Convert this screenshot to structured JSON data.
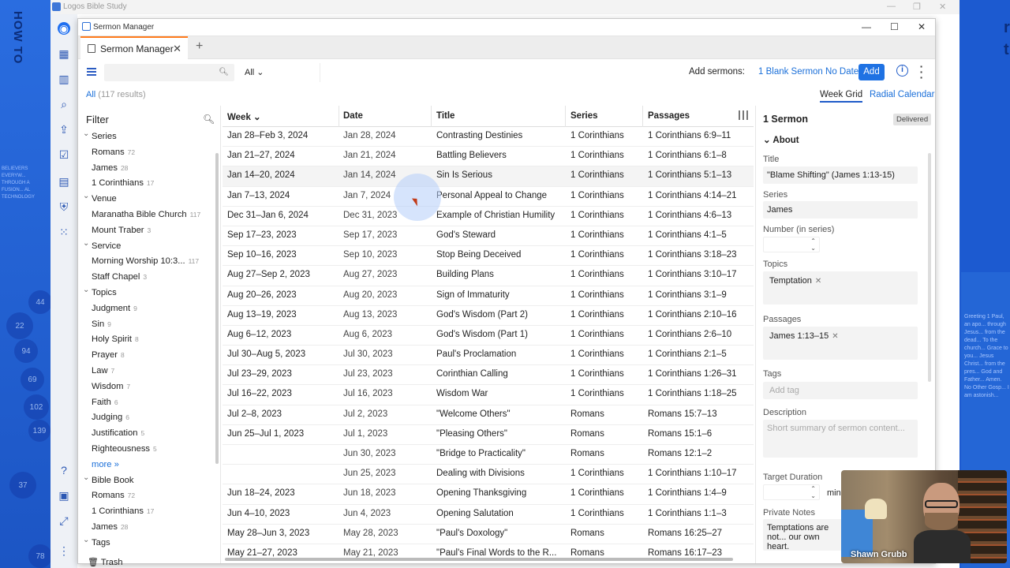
{
  "background": {
    "left_header": "HOW TO",
    "left_text": "BELIEVERS EVERYW... THROUGH A FUSION... AL TECHNOLOGY",
    "left_circles": [
      "44",
      "22",
      "94",
      "69",
      "102",
      "139",
      "37",
      "78"
    ],
    "right_letters": [
      "r",
      "t"
    ],
    "right_doc": "Greeting 1 Paul, an apo... through Jesus... from the dead... To the church... Grace to you... Jesus Christ... from the pres... God and Father... Amen. No Other Gosp... I am astonish..."
  },
  "logos": {
    "title": "Logos Bible Study"
  },
  "window": {
    "title": "Sermon Manager",
    "tab_label": "Sermon Manager"
  },
  "toolbar": {
    "search_placeholder": "",
    "filter_dropdown": "All",
    "add_sermons_label": "Add sermons:",
    "blank_sermon_link": "1 Blank Sermon No Date",
    "add_button": "Add"
  },
  "results": {
    "scope": "All",
    "count": "(117 results)"
  },
  "views": {
    "week_grid": "Week Grid",
    "radial_calendar": "Radial Calendar"
  },
  "filter": {
    "title": "Filter",
    "more_label": "more »",
    "trash_label": "Trash",
    "rows": [
      {
        "kind": "group",
        "label": "Series"
      },
      {
        "kind": "item",
        "label": "Romans",
        "count": "72"
      },
      {
        "kind": "item",
        "label": "James",
        "count": "28"
      },
      {
        "kind": "item",
        "label": "1 Corinthians",
        "count": "17"
      },
      {
        "kind": "group",
        "label": "Venue"
      },
      {
        "kind": "item",
        "label": "Maranatha Bible Church",
        "count": "117"
      },
      {
        "kind": "item",
        "label": "Mount Traber",
        "count": "3"
      },
      {
        "kind": "group",
        "label": "Service"
      },
      {
        "kind": "item",
        "label": "Morning Worship 10:3...",
        "count": "117"
      },
      {
        "kind": "item",
        "label": "Staff Chapel",
        "count": "3"
      },
      {
        "kind": "group",
        "label": "Topics"
      },
      {
        "kind": "item",
        "label": "Judgment",
        "count": "9"
      },
      {
        "kind": "item",
        "label": "Sin",
        "count": "9"
      },
      {
        "kind": "item",
        "label": "Holy Spirit",
        "count": "8"
      },
      {
        "kind": "item",
        "label": "Prayer",
        "count": "8"
      },
      {
        "kind": "item",
        "label": "Law",
        "count": "7"
      },
      {
        "kind": "item",
        "label": "Wisdom",
        "count": "7"
      },
      {
        "kind": "item",
        "label": "Faith",
        "count": "6"
      },
      {
        "kind": "item",
        "label": "Judging",
        "count": "6"
      },
      {
        "kind": "item",
        "label": "Justification",
        "count": "5"
      },
      {
        "kind": "item",
        "label": "Righteousness",
        "count": "5"
      },
      {
        "kind": "more",
        "label": "more »"
      },
      {
        "kind": "group",
        "label": "Bible Book"
      },
      {
        "kind": "item",
        "label": "Romans",
        "count": "72"
      },
      {
        "kind": "item",
        "label": "1 Corinthians",
        "count": "17"
      },
      {
        "kind": "item",
        "label": "James",
        "count": "28"
      },
      {
        "kind": "group",
        "label": "Tags"
      }
    ]
  },
  "grid": {
    "columns": {
      "week": "Week",
      "date": "Date",
      "title": "Title",
      "series": "Series",
      "passages": "Passages"
    },
    "rows": [
      [
        "Jan 28–Feb 3, 2024",
        "Jan 28, 2024",
        "Contrasting Destinies",
        "1 Corinthians",
        "1 Corinthians 6:9–11"
      ],
      [
        "Jan 21–27, 2024",
        "Jan 21, 2024",
        "Battling Believers",
        "1 Corinthians",
        "1 Corinthians 6:1–8"
      ],
      [
        "Jan 14–20, 2024",
        "Jan 14, 2024",
        "Sin Is Serious",
        "1 Corinthians",
        "1 Corinthians 5:1–13"
      ],
      [
        "Jan 7–13, 2024",
        "Jan 7, 2024",
        "Personal Appeal to Change",
        "1 Corinthians",
        "1 Corinthians 4:14–21"
      ],
      [
        "Dec 31–Jan 6, 2024",
        "Dec 31, 2023",
        "Example of Christian Humility",
        "1 Corinthians",
        "1 Corinthians 4:6–13"
      ],
      [
        "Sep 17–23, 2023",
        "Sep 17, 2023",
        "God's Steward",
        "1 Corinthians",
        "1 Corinthians 4:1–5"
      ],
      [
        "Sep 10–16, 2023",
        "Sep 10, 2023",
        "Stop Being Deceived",
        "1 Corinthians",
        "1 Corinthians 3:18–23"
      ],
      [
        "Aug 27–Sep 2, 2023",
        "Aug 27, 2023",
        "Building Plans",
        "1 Corinthians",
        "1 Corinthians 3:10–17"
      ],
      [
        "Aug 20–26, 2023",
        "Aug 20, 2023",
        "Sign of Immaturity",
        "1 Corinthians",
        "1 Corinthians 3:1–9"
      ],
      [
        "Aug 13–19, 2023",
        "Aug 13, 2023",
        "God's Wisdom (Part 2)",
        "1 Corinthians",
        "1 Corinthians 2:10–16"
      ],
      [
        "Aug 6–12, 2023",
        "Aug 6, 2023",
        "God's Wisdom (Part 1)",
        "1 Corinthians",
        "1 Corinthians 2:6–10"
      ],
      [
        "Jul 30–Aug 5, 2023",
        "Jul 30, 2023",
        "Paul's Proclamation",
        "1 Corinthians",
        "1 Corinthians 2:1–5"
      ],
      [
        "Jul 23–29, 2023",
        "Jul 23, 2023",
        "Corinthian Calling",
        "1 Corinthians",
        "1 Corinthians 1:26–31"
      ],
      [
        "Jul 16–22, 2023",
        "Jul 16, 2023",
        "Wisdom War",
        "1 Corinthians",
        "1 Corinthians 1:18–25"
      ],
      [
        "Jul 2–8, 2023",
        "Jul 2, 2023",
        "\"Welcome Others\"",
        "Romans",
        "Romans 15:7–13"
      ],
      [
        "Jun 25–Jul 1, 2023",
        "Jul 1, 2023",
        "\"Pleasing Others\"",
        "Romans",
        "Romans 15:1–6"
      ],
      [
        "",
        "Jun 30, 2023",
        "\"Bridge to Practicality\"",
        "Romans",
        "Romans 12:1–2"
      ],
      [
        "",
        "Jun 25, 2023",
        "Dealing with Divisions",
        "1 Corinthians",
        "1 Corinthians 1:10–17"
      ],
      [
        "Jun 18–24, 2023",
        "Jun 18, 2023",
        "Opening Thanksgiving",
        "1 Corinthians",
        "1 Corinthians 1:4–9"
      ],
      [
        "Jun 4–10, 2023",
        "Jun 4, 2023",
        "Opening Salutation",
        "1 Corinthians",
        "1 Corinthians 1:1–3"
      ],
      [
        "May 28–Jun 3, 2023",
        "May 28, 2023",
        "\"Paul's Doxology\"",
        "Romans",
        "Romans 16:25–27"
      ],
      [
        "May 21–27, 2023",
        "May 21, 2023",
        "\"Paul's Final Words to the R...",
        "Romans",
        "Romans 16:17–23"
      ]
    ]
  },
  "detail": {
    "header": "1 Sermon",
    "status": "Delivered",
    "section": "About",
    "title_label": "Title",
    "title_value": "\"Blame Shifting\" (James 1:13-15)",
    "series_label": "Series",
    "series_value": "James",
    "number_label": "Number (in series)",
    "topics_label": "Topics",
    "topic_chip": "Temptation",
    "passages_label": "Passages",
    "passage_chip": "James 1:13–15",
    "tags_label": "Tags",
    "tags_placeholder": "Add tag",
    "description_label": "Description",
    "description_placeholder": "Short summary of sermon content...",
    "duration_label": "Target Duration",
    "duration_unit": "min",
    "notes_label": "Private Notes",
    "notes_value": "Temptations are not... our own heart."
  },
  "webcam": {
    "name": "Shawn Grubb"
  }
}
